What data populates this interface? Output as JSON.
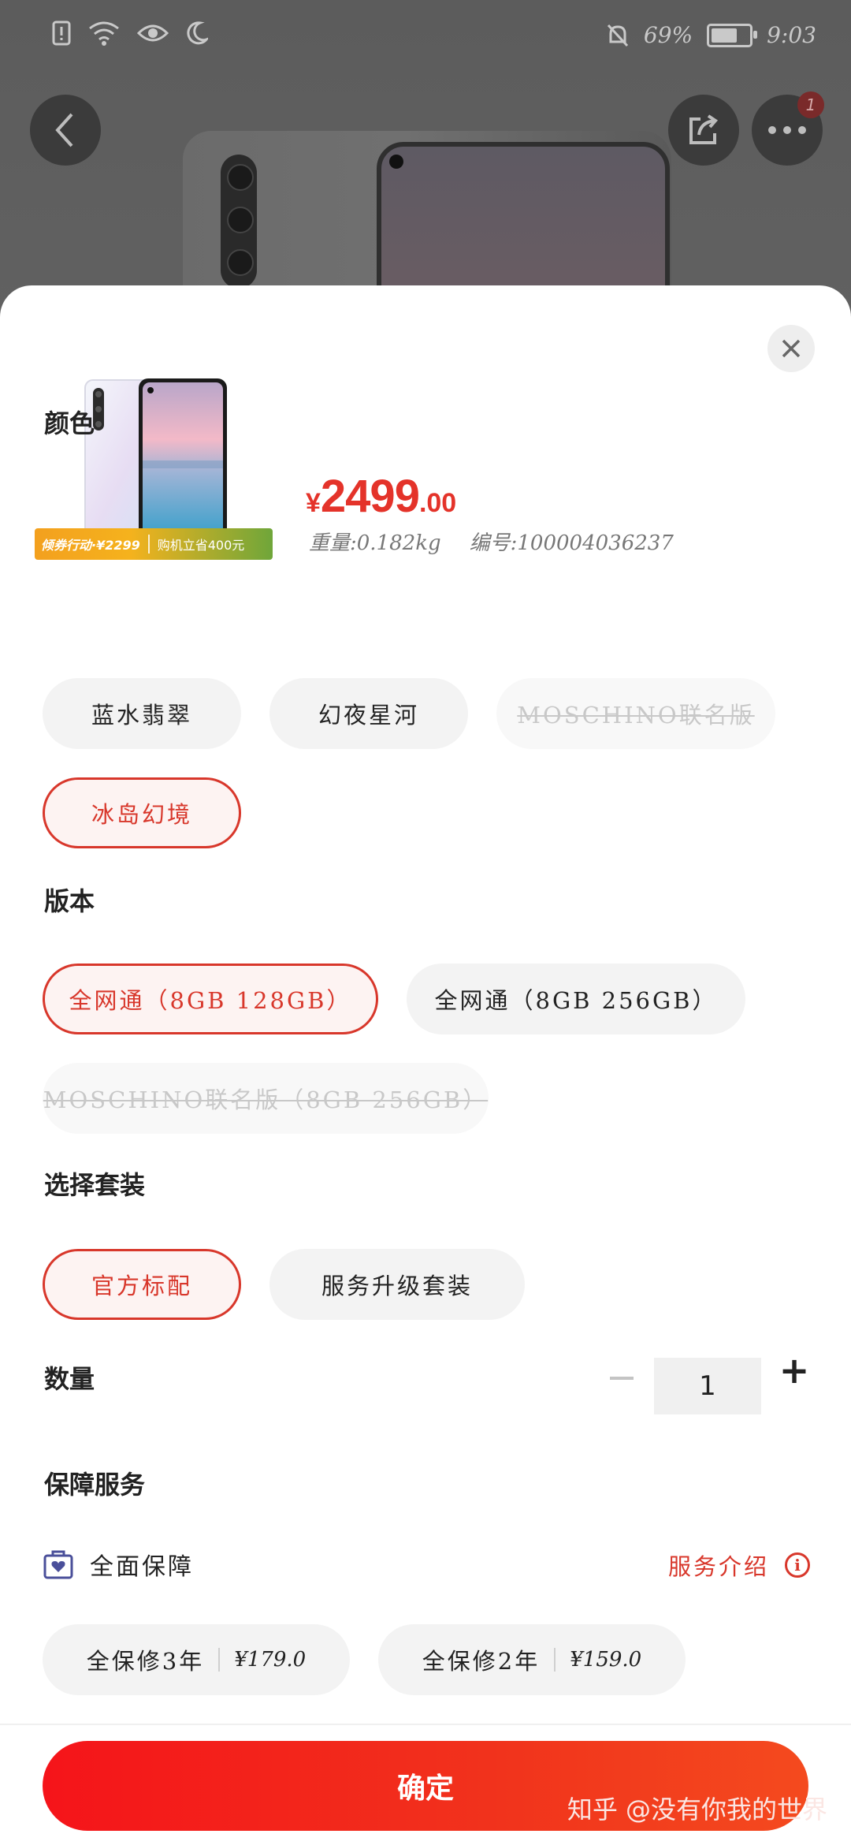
{
  "status_bar": {
    "battery_text": "69%",
    "battery_level": 0.69,
    "time": "9:03"
  },
  "header": {
    "back_icon": "chevron-left-icon",
    "share_icon": "share-icon",
    "more_icon": "more-icon",
    "more_badge": "1"
  },
  "product": {
    "promo_text": "倾券行动·¥2299",
    "promo_sub": "购机立省400元",
    "price_currency": "¥",
    "price_int": "2499",
    "price_dec": ".00",
    "weight": "重量:0.182kg",
    "sku": "编号:100004036237"
  },
  "color_section": {
    "title": "颜色",
    "options": [
      {
        "label": "蓝水翡翠",
        "state": "normal"
      },
      {
        "label": "幻夜星河",
        "state": "normal"
      },
      {
        "label": "MOSCHINO联名版",
        "state": "disabled"
      },
      {
        "label": "冰岛幻境",
        "state": "selected"
      }
    ]
  },
  "version_section": {
    "title": "版本",
    "options": [
      {
        "label": "全网通（8GB 128GB）",
        "state": "selected"
      },
      {
        "label": "全网通（8GB 256GB）",
        "state": "normal"
      },
      {
        "label": "MOSCHINO联名版（8GB 256GB）",
        "state": "disabled"
      }
    ]
  },
  "bundle_section": {
    "title": "选择套装",
    "options": [
      {
        "label": "官方标配",
        "state": "selected"
      },
      {
        "label": "服务升级套装",
        "state": "normal"
      }
    ]
  },
  "quantity": {
    "title": "数量",
    "value": "1",
    "minus": "−",
    "plus": "+"
  },
  "guarantee": {
    "title": "保障服务",
    "plan_label": "全面保障",
    "service_link": "服务介绍",
    "info_glyph": "i",
    "plans": [
      {
        "name": "全保修3年",
        "price": "¥179.0"
      },
      {
        "name": "全保修2年",
        "price": "¥159.0"
      }
    ]
  },
  "confirm_label": "确定",
  "watermark": "知乎 @没有你我的世界",
  "colors": {
    "accent": "#d8372b",
    "price": "#e4332a",
    "confirm_start": "#f5141a",
    "confirm_end": "#f44a1e"
  }
}
